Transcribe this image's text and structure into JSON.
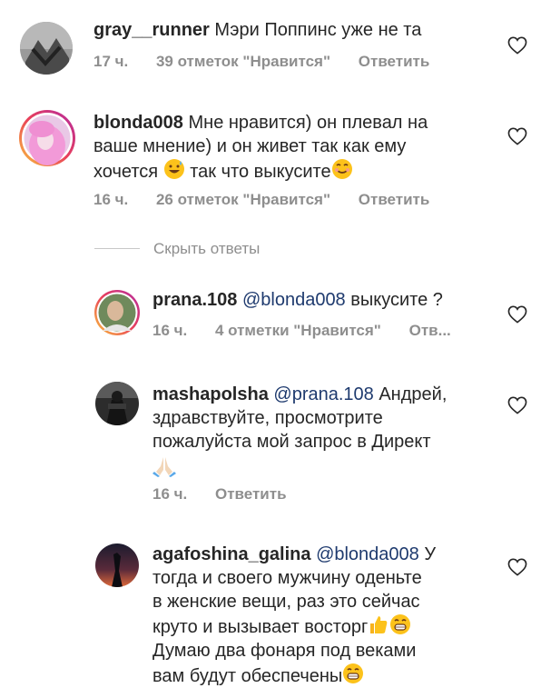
{
  "comments": [
    {
      "username": "gray__runner",
      "text": "Мэри Поппинс уже не та",
      "time": "17 ч.",
      "likes": "39 отметок \"Нравится\"",
      "reply": "Ответить"
    },
    {
      "username": "blonda008",
      "text_line1": "Мне нравится) он плевал на",
      "text_line2": "ваше мнение) и он живет так как ему",
      "text_line3a": "хочется",
      "text_line3b": "так что выкусите",
      "time": "16 ч.",
      "likes": "26 отметок \"Нравится\"",
      "reply": "Ответить"
    }
  ],
  "hide_replies": "Скрыть ответы",
  "replies": [
    {
      "username": "prana.108",
      "mention": "@blonda008",
      "text": "выкусите ?",
      "time": "16 ч.",
      "likes": "4 отметки \"Нравится\"",
      "reply": "Отв..."
    },
    {
      "username": "mashapolsha",
      "mention": "@prana.108",
      "text_line1": "Андрей,",
      "text_line2": "здравствуйте, просмотрите",
      "text_line3": "пожалуйста мой запрос в Директ",
      "time": "16 ч.",
      "reply": "Ответить"
    },
    {
      "username": "agafoshina_galina",
      "mention": "@blonda008",
      "text_line1": "У",
      "text_line2": "тогда и своего мужчину оденьте",
      "text_line3": "в женские вещи, раз это сейчас",
      "text_line4": "круто и вызывает восторг",
      "text_line5": "Думаю два фонаря под веками",
      "text_line6": "вам будут обеспечены"
    }
  ],
  "icons": {
    "like": "heart-outline-icon",
    "emoji_sweat": "grinning-sweat-emoji",
    "emoji_smile": "smiling-face-emoji",
    "emoji_pray": "folded-hands-emoji",
    "emoji_thumbs": "thumbs-up-emoji",
    "emoji_grin": "grinning-face-emoji"
  },
  "colors": {
    "text": "#262626",
    "meta": "#8e8e8e",
    "mention": "#1e3a6e",
    "story_ring_start": "#f9c43b",
    "story_ring_end": "#d1237f"
  }
}
